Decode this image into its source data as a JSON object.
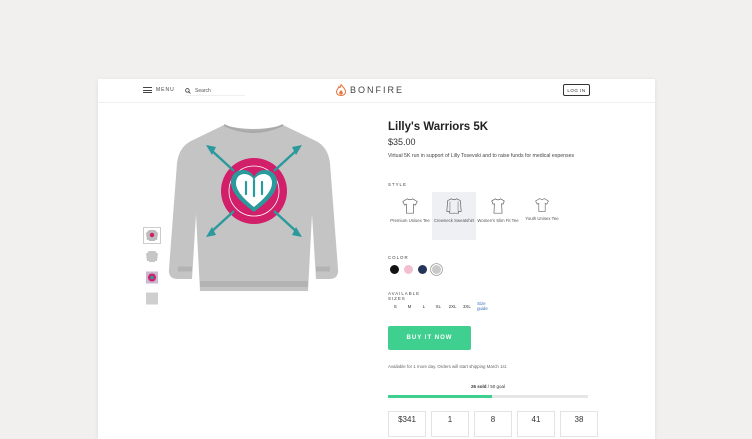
{
  "header": {
    "menu_label": "MENU",
    "search_placeholder": "Search",
    "brand": "BONFIRE",
    "login_label": "LOG IN"
  },
  "product": {
    "title": "Lilly's Warriors 5K",
    "price": "$35.00",
    "description": "Virtual 5K run in support of Lilly Tosevski and to raise funds for medical expenses",
    "style_label": "STYLE",
    "styles": [
      {
        "name": "Premium Unisex Tee",
        "selected": false
      },
      {
        "name": "Crewneck Sweatshirt",
        "selected": true
      },
      {
        "name": "Women's Slim Fit Tee",
        "selected": false
      },
      {
        "name": "Youth Unisex Tee",
        "selected": false
      }
    ],
    "color_label": "COLOR",
    "colors": [
      {
        "hex": "#111111",
        "selected": false
      },
      {
        "hex": "#f2bfd0",
        "selected": false
      },
      {
        "hex": "#25355a",
        "selected": false
      },
      {
        "hex": "#c9c9c9",
        "selected": true
      }
    ],
    "sizes_label": "AVAILABLE SIZES",
    "sizes": [
      "S",
      "M",
      "L",
      "XL",
      "2XL",
      "3XL"
    ],
    "size_guide": "Size guide",
    "buy_label": "BUY IT NOW",
    "availability": "Available for 1 more day. Orders will start shipping March 1st.",
    "sold": "26 sold",
    "goal": " / 50 goal",
    "progress_fraction": 0.52,
    "stats": [
      "$341",
      "1",
      "8",
      "41",
      "38"
    ],
    "thumbnails": [
      "sweatshirt-front",
      "sweatshirt-back",
      "design-closeup",
      "sweatshirt-plain"
    ],
    "accent": "#3fcf8f",
    "design_pink": "#d11f6a",
    "design_teal": "#2a9a9c"
  }
}
